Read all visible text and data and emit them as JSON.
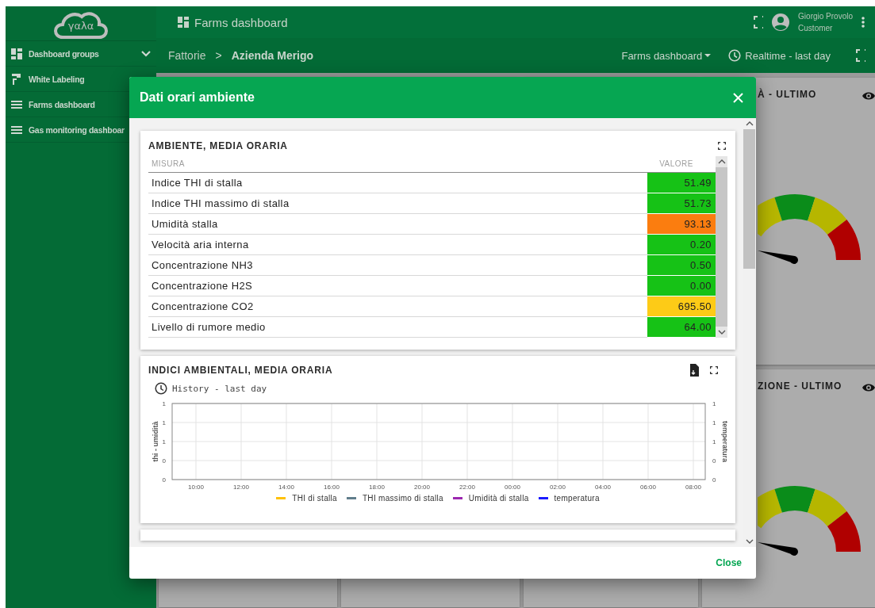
{
  "sidebar": {
    "logo": "γαλα",
    "items": [
      {
        "label": "Dashboard groups",
        "kind": "group",
        "expanded": true
      },
      {
        "label": "White Labeling",
        "kind": "labeling"
      },
      {
        "label": "Farms dashboard",
        "kind": "dashboard"
      },
      {
        "label": "Gas monitoring dashboar",
        "kind": "dashboard"
      }
    ]
  },
  "top_bar": {
    "title": "Farms dashboard",
    "user": {
      "name": "Giorgio Provolo",
      "role": "Customer"
    }
  },
  "sub_bar": {
    "breadcrumb": [
      "Fattorie",
      "Azienda Merigo"
    ],
    "separator": ">",
    "dashboard_select": "Farms dashboard",
    "timewindow": "Realtime - last day"
  },
  "background_cards": [
    {
      "title": "À - ULTIMO"
    },
    {
      "title": "ZIONE - ULTIMO"
    }
  ],
  "dialog": {
    "title": "Dati orari ambiente",
    "close_label": "Close",
    "widgets": [
      {
        "kind": "table",
        "title": "AMBIENTE, MEDIA ORARIA",
        "columns": [
          "MISURA",
          "VALORE"
        ],
        "rows": [
          {
            "name": "Indice THI di stalla",
            "value": "51.49",
            "color": "#16c216"
          },
          {
            "name": "Indice THI massimo di stalla",
            "value": "51.73",
            "color": "#16c216"
          },
          {
            "name": "Umidità stalla",
            "value": "93.13",
            "color": "#fb7d0f"
          },
          {
            "name": "Velocità aria interna",
            "value": "0.20",
            "color": "#16c216"
          },
          {
            "name": "Concentrazione NH3",
            "value": "0.50",
            "color": "#16c216"
          },
          {
            "name": "Concentrazione H2S",
            "value": "0.00",
            "color": "#16c216"
          },
          {
            "name": "Concentrazione CO2",
            "value": "695.50",
            "color": "#fdcb17"
          },
          {
            "name": "Livello di rumore medio",
            "value": "64.00",
            "color": "#16c216"
          }
        ]
      },
      {
        "kind": "chart",
        "title": "INDICI AMBIENTALI, MEDIA ORARIA",
        "timewindow": "History - last day",
        "left_axis": {
          "label": "thi - umidità",
          "ticks": [
            "1",
            "1",
            "1",
            "0",
            "0"
          ]
        },
        "right_axis": {
          "label": "temperatura",
          "ticks": [
            "1",
            "1",
            "1",
            "0",
            "0"
          ]
        },
        "x_labels": [
          "10:00",
          "12:00",
          "14:00",
          "16:00",
          "18:00",
          "20:00",
          "22:00",
          "00:00",
          "02:00",
          "04:00",
          "06:00",
          "08:00"
        ],
        "legend": [
          {
            "name": "THI di stalla",
            "color": "#ffc107"
          },
          {
            "name": "THI massimo di stalla",
            "color": "#607d8b"
          },
          {
            "name": "Umidità di stalla",
            "color": "#9c27b0"
          },
          {
            "name": "temperatura",
            "color": "#1a1aff"
          }
        ]
      }
    ]
  }
}
